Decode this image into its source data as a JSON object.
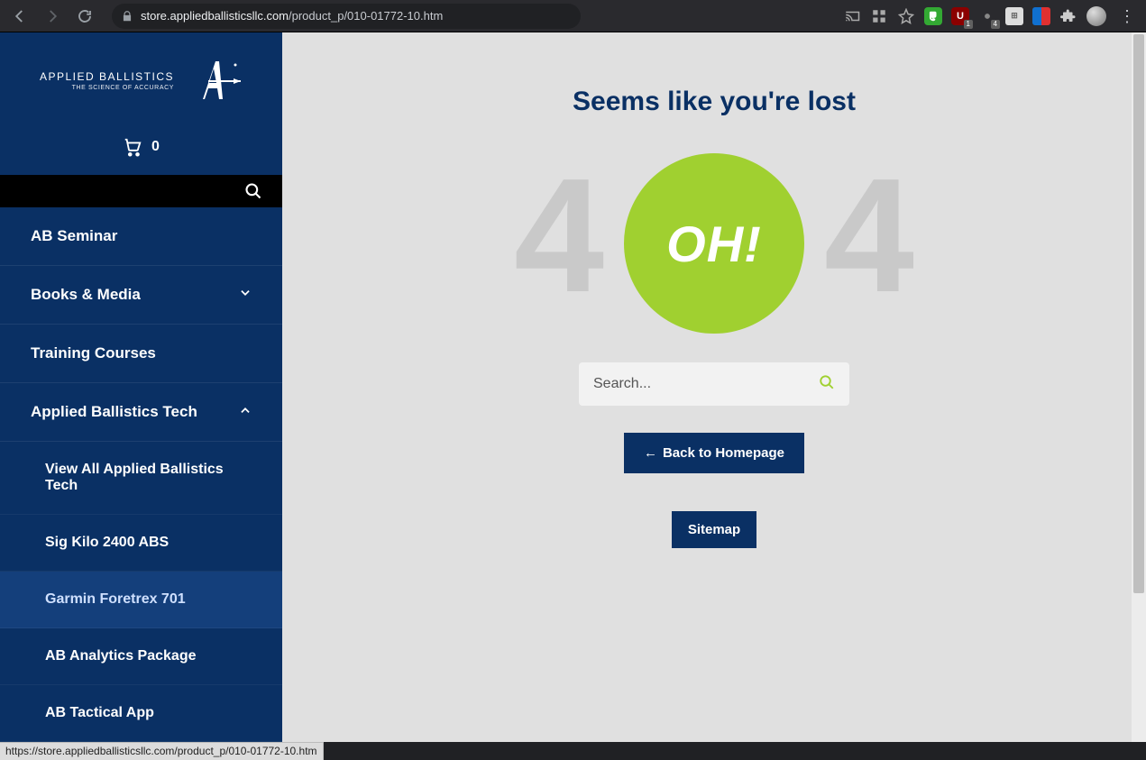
{
  "browser": {
    "url_domain": "store.appliedballisticsllc.com",
    "url_path": "/product_p/010-01772-10.htm",
    "badge1": "1",
    "badge2": "4"
  },
  "sidebar": {
    "brand": "APPLIED BALLISTICS",
    "tagline": "THE SCIENCE OF ACCURACY",
    "cart_count": "0",
    "items": [
      {
        "label": "AB Seminar",
        "expand": null
      },
      {
        "label": "Books & Media",
        "expand": "down"
      },
      {
        "label": "Training Courses",
        "expand": null
      },
      {
        "label": "Applied Ballistics Tech",
        "expand": "up"
      }
    ],
    "sub_items": [
      {
        "label": "View All Applied Ballistics Tech",
        "hovered": false
      },
      {
        "label": "Sig Kilo 2400 ABS",
        "hovered": false
      },
      {
        "label": "Garmin Foretrex 701",
        "hovered": true
      },
      {
        "label": "AB Analytics Package",
        "hovered": false
      },
      {
        "label": "AB Tactical App",
        "hovered": false
      }
    ]
  },
  "main": {
    "heading": "Seems like you're lost",
    "left4": "4",
    "right4": "4",
    "oh": "OH!",
    "search_placeholder": "Search...",
    "back_label": "Back to Homepage",
    "sitemap_label": "Sitemap"
  },
  "status": {
    "text": "https://store.appliedballisticsllc.com/product_p/010-01772-10.htm"
  }
}
